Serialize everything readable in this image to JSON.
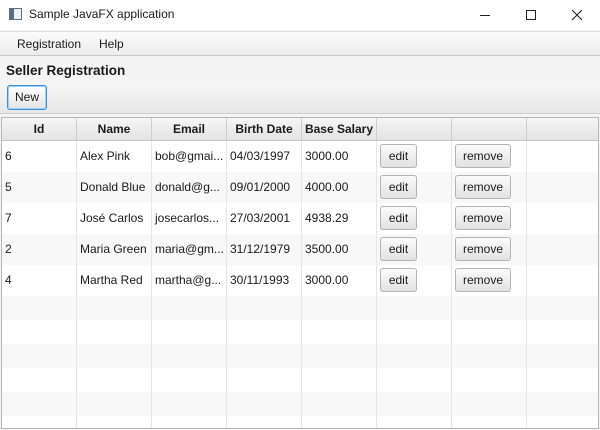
{
  "window": {
    "title": "Sample JavaFX application",
    "icons": {
      "app": "app-window-icon",
      "minimize": "minimize-icon",
      "maximize": "maximize-icon",
      "close": "close-icon"
    }
  },
  "menu": {
    "items": [
      {
        "label": "Registration"
      },
      {
        "label": "Help"
      }
    ]
  },
  "page": {
    "heading": "Seller Registration"
  },
  "toolbar": {
    "new_label": "New"
  },
  "table": {
    "columns": [
      "Id",
      "Name",
      "Email",
      "Birth Date",
      "Base Salary",
      "",
      ""
    ],
    "rows": [
      {
        "id": "6",
        "name": "Alex Pink",
        "email": "bob@gmai...",
        "birth_date": "04/03/1997",
        "base_salary": "3000.00",
        "edit": "edit",
        "remove": "remove"
      },
      {
        "id": "5",
        "name": "Donald Blue",
        "email": "donald@g...",
        "birth_date": "09/01/2000",
        "base_salary": "4000.00",
        "edit": "edit",
        "remove": "remove"
      },
      {
        "id": "7",
        "name": "José Carlos",
        "email": "josecarlos...",
        "birth_date": "27/03/2001",
        "base_salary": "4938.29",
        "edit": "edit",
        "remove": "remove"
      },
      {
        "id": "2",
        "name": "Maria Green",
        "email": "maria@gm...",
        "birth_date": "31/12/1979",
        "base_salary": "3500.00",
        "edit": "edit",
        "remove": "remove"
      },
      {
        "id": "4",
        "name": "Martha Red",
        "email": "martha@g...",
        "birth_date": "30/11/1993",
        "base_salary": "3000.00",
        "edit": "edit",
        "remove": "remove"
      }
    ]
  },
  "colors": {
    "focus_ring": "#3a8fd6",
    "header_bg": "#e9e9e9",
    "row_alt_bg": "#f8f8f8"
  }
}
